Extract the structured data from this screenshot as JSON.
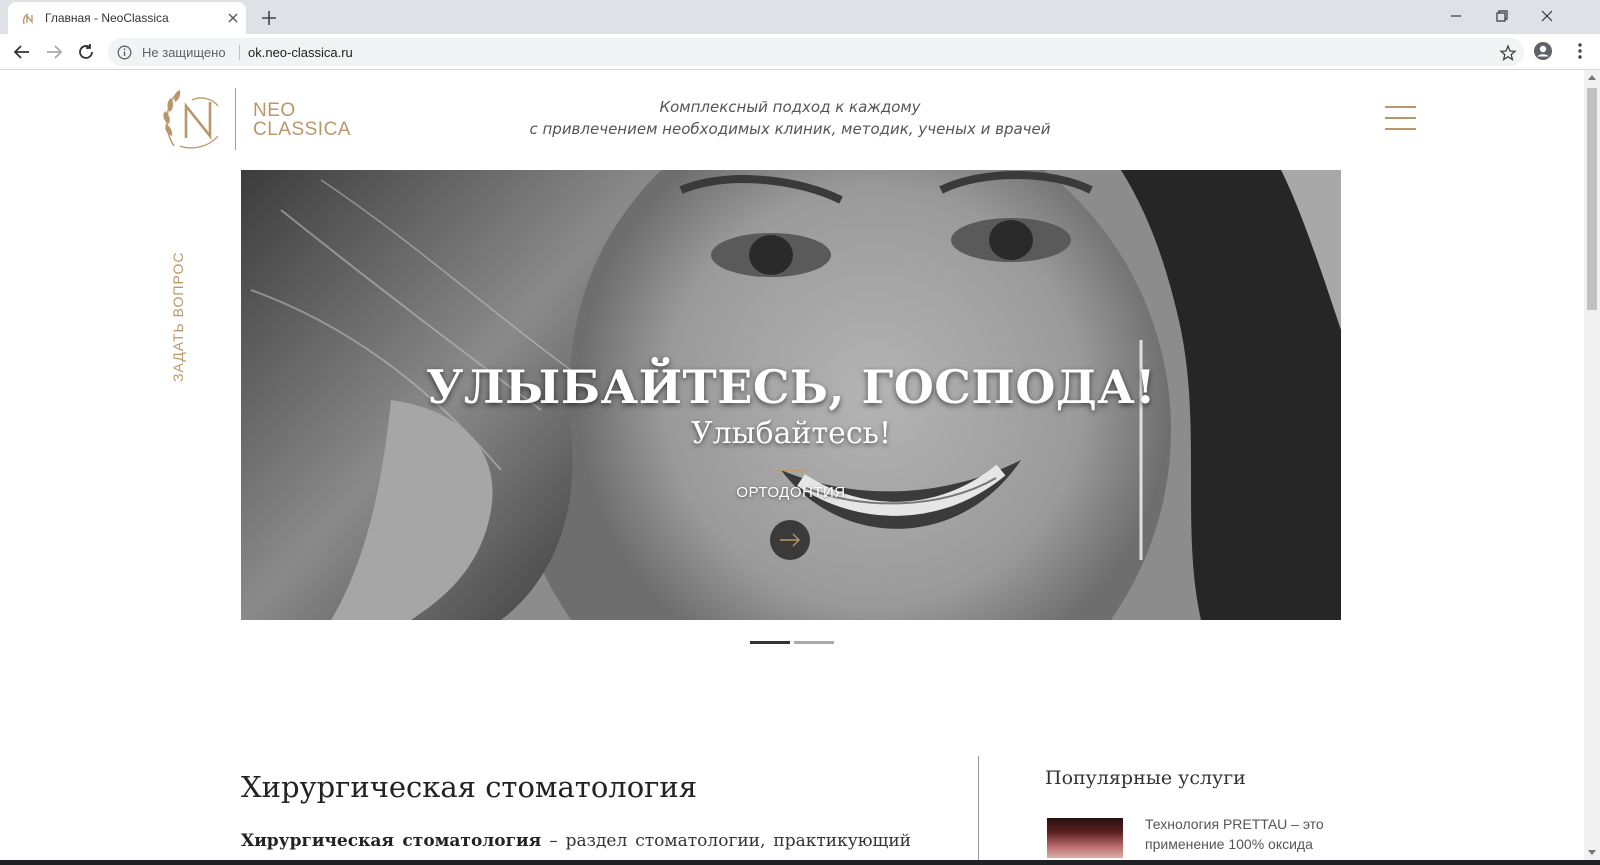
{
  "browser": {
    "tab_title": "Главная - NeoClassica",
    "security_label": "Не защищено",
    "url": "ok.neo-classica.ru"
  },
  "site": {
    "logo_text_line1": "NEO",
    "logo_text_line2": "CLASSICA",
    "tagline_line1": "Комплексный подход к каждому",
    "tagline_line2": "с привлечением необходимых клиник, методик, ученых и врачей",
    "ask_question": "ЗАДАТЬ ВОПРОС",
    "accent_color": "#b9976a"
  },
  "hero": {
    "title": "УЛЫБАЙТЕСЬ, ГОСПОДА!",
    "subtitle": "Улыбайтесь!",
    "category": "ОРТОДОНТИЯ",
    "slides_count": 2,
    "active_slide": 1
  },
  "content": {
    "section_title": "Хирургическая стоматология",
    "section_text_bold": "Хирургическая стоматология",
    "section_text_rest": " – раздел стоматологии, практикующий такие"
  },
  "sidebar": {
    "popular_title": "Популярные услуги",
    "popular_item_text": "Технология PRETTAU – это применение 100% оксида"
  }
}
